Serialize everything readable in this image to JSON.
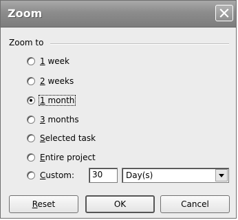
{
  "window": {
    "title": "Zoom",
    "close_icon": "close-icon"
  },
  "group": {
    "label": "Zoom to"
  },
  "options": [
    {
      "prefix": "",
      "accel": "1",
      "rest": " week",
      "checked": false
    },
    {
      "prefix": "",
      "accel": "2",
      "rest": " weeks",
      "checked": false
    },
    {
      "prefix": "",
      "accel": "1",
      "rest": " month",
      "checked": true
    },
    {
      "prefix": "",
      "accel": "3",
      "rest": " months",
      "checked": false
    },
    {
      "prefix": "",
      "accel": "S",
      "rest": "elected task",
      "checked": false
    },
    {
      "prefix": "",
      "accel": "E",
      "rest": "ntire project",
      "checked": false
    },
    {
      "prefix": "",
      "accel": "C",
      "rest": "ustom:",
      "checked": false
    }
  ],
  "custom": {
    "value": "30",
    "unit": "Day(s)"
  },
  "buttons": {
    "reset": {
      "accel": "R",
      "rest": "eset"
    },
    "ok": "OK",
    "cancel": "Cancel"
  }
}
